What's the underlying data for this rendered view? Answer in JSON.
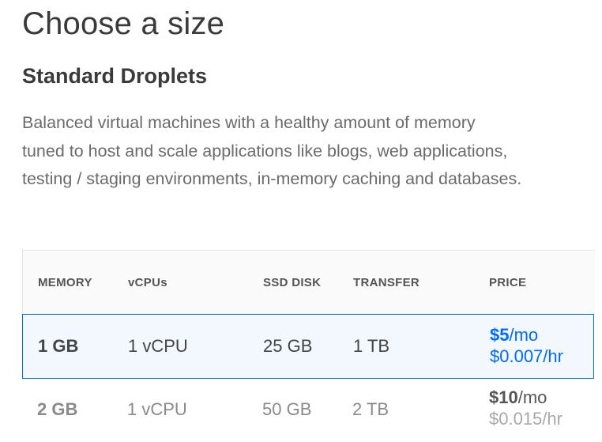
{
  "page": {
    "title": "Choose a size"
  },
  "section": {
    "title": "Standard Droplets",
    "description_lines": [
      "Balanced virtual machines with a healthy amount of memory",
      "tuned to host and scale applications like blogs, web applications,",
      "testing / staging environments, in-memory caching and databases."
    ]
  },
  "table": {
    "headers": {
      "memory": "MEMORY",
      "vcpus": "vCPUs",
      "disk": "SSD DISK",
      "transfer": "TRANSFER",
      "price": "PRICE"
    },
    "rows": [
      {
        "memory": "1 GB",
        "vcpus": "1 vCPU",
        "disk": "25 GB",
        "transfer": "1 TB",
        "price_mo_amount": "$5",
        "price_mo_unit": "/mo",
        "price_hr": "$0.007/hr",
        "selected": true
      },
      {
        "memory": "2 GB",
        "vcpus": "1 vCPU",
        "disk": "50 GB",
        "transfer": "2 TB",
        "price_mo_amount": "$10",
        "price_mo_unit": "/mo",
        "price_hr": "$0.015/hr",
        "selected": false
      }
    ]
  },
  "colors": {
    "accent": "#0069ff",
    "selected_row_bg": "#f3f8ff"
  }
}
